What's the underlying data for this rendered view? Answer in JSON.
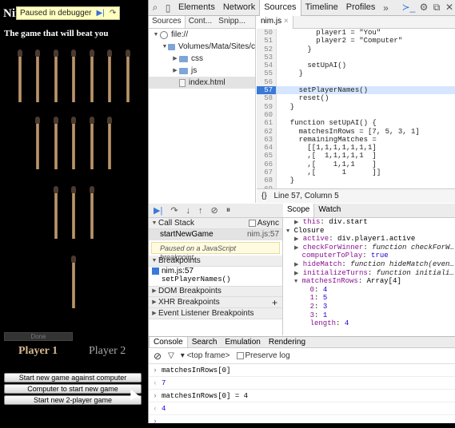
{
  "game": {
    "title_partial": "Nim",
    "subtitle": "The game that will beat you",
    "debug_banner": {
      "label": "Paused in debugger",
      "resume_glyph": "▶|",
      "step_glyph": "↷"
    },
    "match_rows": [
      7,
      5,
      3,
      1
    ],
    "done_label": "Done",
    "player1": "Player 1",
    "player2": "Player 2",
    "buttons": [
      "Start new game against computer",
      "Computer to start new game",
      "Start new 2-player game"
    ]
  },
  "devtools": {
    "toolbar": {
      "tabs": [
        "Elements",
        "Network",
        "Sources",
        "Timeline",
        "Profiles"
      ],
      "active": "Sources",
      "icons": {
        "search": "⌕",
        "device": "▯",
        "more": "»",
        "console": "≻_",
        "settings": "⚙",
        "dock": "⧉",
        "close": "✕"
      }
    },
    "navigator": {
      "tabs": [
        "Sources",
        "Cont...",
        "Snipp..."
      ],
      "tree": [
        {
          "label": "file://",
          "type": "globe",
          "indent": 0,
          "open": true
        },
        {
          "label": "Volumes/Mata/Sites/c",
          "type": "folder",
          "indent": 1,
          "open": true
        },
        {
          "label": "css",
          "type": "folder",
          "indent": 2,
          "open": false
        },
        {
          "label": "js",
          "type": "folder",
          "indent": 2,
          "open": false
        },
        {
          "label": "index.html",
          "type": "file",
          "indent": 2,
          "open": null,
          "selected": true
        }
      ]
    },
    "editor": {
      "file": "nim.js",
      "exec_line": 57,
      "lines": [
        {
          "n": "50",
          "t": "        player1 = \"You\""
        },
        {
          "n": "51",
          "t": "        player2 = \"Computer\""
        },
        {
          "n": "52",
          "t": "      }"
        },
        {
          "n": "53",
          "t": ""
        },
        {
          "n": "54",
          "t": "      setUpAI()"
        },
        {
          "n": "55",
          "t": "    }"
        },
        {
          "n": "56",
          "t": ""
        },
        {
          "n": "57",
          "t": "    setPlayerNames()"
        },
        {
          "n": "58",
          "t": "    reset()"
        },
        {
          "n": "59",
          "t": "  }"
        },
        {
          "n": "60",
          "t": ""
        },
        {
          "n": "61",
          "t": "  function setUpAI() {"
        },
        {
          "n": "62",
          "t": "    matchesInRows = [7, 5, 3, 1]"
        },
        {
          "n": "63",
          "t": "    remainingMatches ="
        },
        {
          "n": "64",
          "t": "      [[1,1,1,1,1,1,1]"
        },
        {
          "n": "65",
          "t": "      ,[  1,1,1,1,1  ]"
        },
        {
          "n": "66",
          "t": "      ,[    1,1,1    ]"
        },
        {
          "n": "67",
          "t": "      ,[      1      ]]"
        },
        {
          "n": "68",
          "t": "  }"
        },
        {
          "n": "69",
          "t": ""
        }
      ],
      "status": "Line 57, Column 5",
      "status_icon": "{}"
    },
    "debugger": {
      "controls": [
        "▶|",
        "↷",
        "↓",
        "↑",
        "⊘",
        "⏸"
      ],
      "call_stack_title": "Call Stack",
      "async_label": "Async",
      "frame_name": "startNewGame",
      "frame_loc": "nim.js:57",
      "paused_msg": "Paused on a JavaScript breakpoint.",
      "breakpoints_title": "Breakpoints",
      "bp_loc": "nim.js:57",
      "bp_code": "setPlayerNames()",
      "sections": [
        "DOM Breakpoints",
        "XHR Breakpoints",
        "Event Listener Breakpoints"
      ],
      "add_glyph": "+"
    },
    "scope": {
      "tabs": [
        "Scope",
        "Watch"
      ],
      "rows": [
        {
          "indent": 1,
          "tri": "▶",
          "key": "this",
          "val": "div.start",
          "vt": "p"
        },
        {
          "indent": 0,
          "tri": "▼",
          "key": "Closure",
          "val": "",
          "vt": "h"
        },
        {
          "indent": 1,
          "tri": "▶",
          "key": "active",
          "val": "div.player1.active",
          "vt": "p"
        },
        {
          "indent": 1,
          "tri": "▶",
          "key": "checkForWinner",
          "val": "function checkForW…",
          "vt": "f"
        },
        {
          "indent": 1,
          "tri": " ",
          "key": "computerToPlay",
          "val": "true",
          "vt": "n"
        },
        {
          "indent": 1,
          "tri": "▶",
          "key": "hideMatch",
          "val": "function hideMatch(even…",
          "vt": "f"
        },
        {
          "indent": 1,
          "tri": "▶",
          "key": "initializeTurns",
          "val": "function initiali…",
          "vt": "f"
        },
        {
          "indent": 1,
          "tri": "▼",
          "key": "matchesInRows",
          "val": "Array[4]",
          "vt": "p"
        },
        {
          "indent": 2,
          "tri": " ",
          "key": "0",
          "val": "4",
          "vt": "n"
        },
        {
          "indent": 2,
          "tri": " ",
          "key": "1",
          "val": "5",
          "vt": "n"
        },
        {
          "indent": 2,
          "tri": " ",
          "key": "2",
          "val": "3",
          "vt": "n"
        },
        {
          "indent": 2,
          "tri": " ",
          "key": "3",
          "val": "1",
          "vt": "n"
        },
        {
          "indent": 2,
          "tri": " ",
          "key": "length",
          "val": "4",
          "vt": "n"
        }
      ]
    },
    "console": {
      "tabs": [
        "Console",
        "Search",
        "Emulation",
        "Rendering"
      ],
      "frame": "<top frame>",
      "preserve_log": "Preserve log",
      "clear_glyph": "⊘",
      "filter_glyph": "▽",
      "entries": [
        {
          "kind": "in",
          "text": "matchesInRows[0]"
        },
        {
          "kind": "out",
          "text": "7"
        },
        {
          "kind": "in",
          "text": "matchesInRows[0] = 4"
        },
        {
          "kind": "out",
          "text": "4"
        },
        {
          "kind": "prompt",
          "text": ""
        }
      ]
    }
  }
}
